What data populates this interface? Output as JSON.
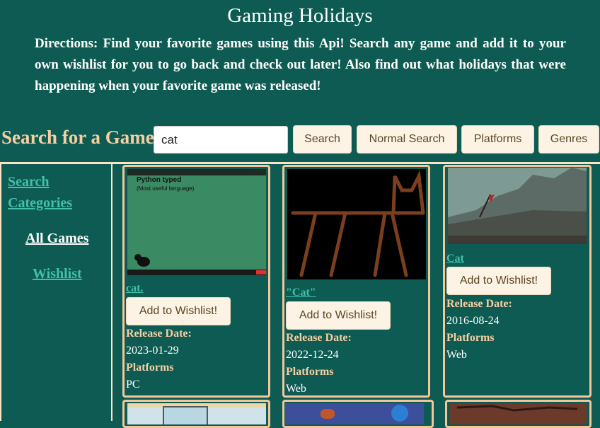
{
  "header": {
    "title": "Gaming Holidays",
    "directions": "Directions: Find your favorite games using this Api! Search any game and add it to your own wishlist for you to go back and check out later! Also find out what holidays that were happening when your favorite game was released!"
  },
  "search": {
    "label": "Search for a Game:",
    "value": "cat",
    "buttons": {
      "search": "Search",
      "normal": "Normal Search",
      "platforms": "Platforms",
      "genres": "Genres"
    }
  },
  "sidebar": {
    "categories": "Search Categories",
    "all_games": "All Games",
    "wishlist": "Wishlist"
  },
  "games": [
    {
      "name": "cat.",
      "wishlist_label": "Add to Wishlist!",
      "release_label": "Release Date:",
      "release_date": "2023-01-29",
      "platforms_label": "Platforms",
      "platforms": "PC",
      "thumb_text_1": "Python typed",
      "thumb_text_2": "(Most useful language)"
    },
    {
      "name": "\"Cat\"",
      "wishlist_label": "Add to Wishlist!",
      "release_label": "Release Date:",
      "release_date": "2022-12-24",
      "platforms_label": "Platforms",
      "platforms": "Web"
    },
    {
      "name": "Cat",
      "wishlist_label": "Add to Wishlist!",
      "release_label": "Release Date:",
      "release_date": "2016-08-24",
      "platforms_label": "Platforms",
      "platforms": "Web"
    }
  ],
  "colors": {
    "background": "#0d5b52",
    "accent": "#f6cfa2",
    "link": "#43c0a8",
    "card_border": "#f4c69a"
  }
}
